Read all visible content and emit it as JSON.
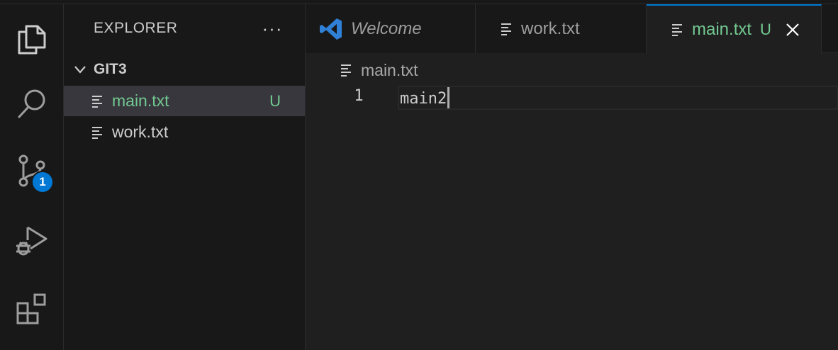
{
  "activity_bar": {
    "items": [
      {
        "icon": "files-icon"
      },
      {
        "icon": "search-icon"
      },
      {
        "icon": "source-control-icon",
        "badge": "1"
      },
      {
        "icon": "run-debug-icon"
      },
      {
        "icon": "extensions-icon"
      }
    ]
  },
  "sidebar": {
    "title": "EXPLORER",
    "more_label": "···",
    "section_title": "GIT3",
    "files": [
      {
        "name": "main.txt",
        "status": "U",
        "selected": true
      },
      {
        "name": "work.txt",
        "status": "",
        "selected": false
      }
    ]
  },
  "tabs": [
    {
      "label": "Welcome",
      "icon": "vscode-logo-icon"
    },
    {
      "label": "work.txt",
      "icon": "file-text-icon"
    },
    {
      "label": "main.txt",
      "icon": "file-text-icon",
      "status": "U",
      "active": true
    }
  ],
  "editor": {
    "breadcrumb": "main.txt",
    "lines": [
      {
        "number": "1",
        "text": "main2"
      }
    ]
  },
  "colors": {
    "accent": "#0078d4",
    "untracked": "#73c991",
    "background": "#181818",
    "editor_background": "#1f1f1f"
  }
}
